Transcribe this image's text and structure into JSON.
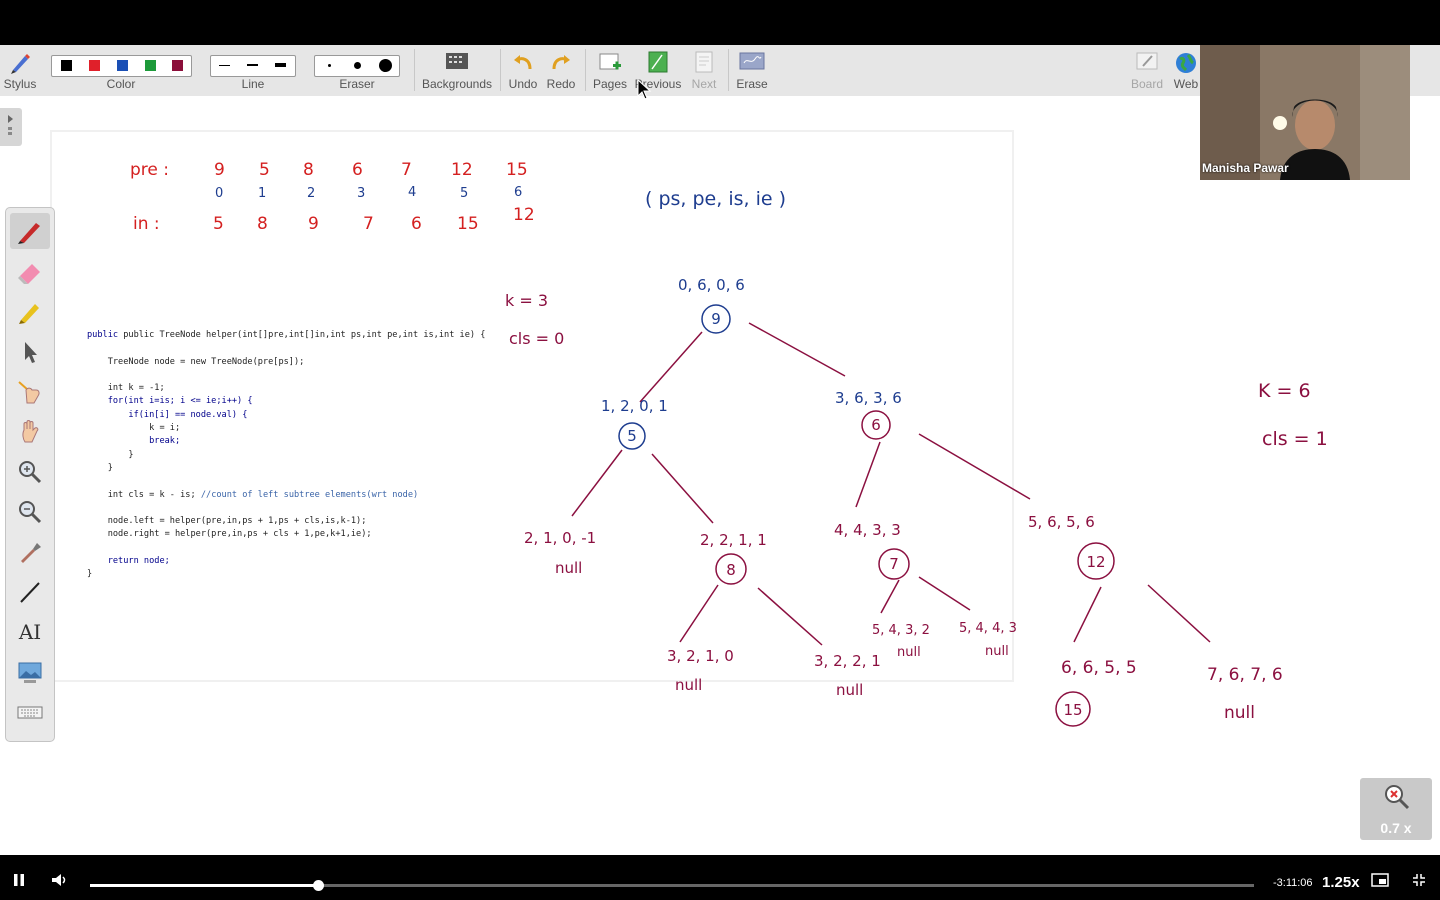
{
  "toolbar": {
    "stylus": "Stylus",
    "color": "Color",
    "line": "Line",
    "eraser": "Eraser",
    "backgrounds": "Backgrounds",
    "undo": "Undo",
    "redo": "Redo",
    "pages": "Pages",
    "previous": "Previous",
    "next": "Next",
    "erase": "Erase",
    "board": "Board",
    "web": "Web",
    "colors": [
      "#000000",
      "#e0202a",
      "#1a4fb5",
      "#1d9a3a",
      "#8b0e3a"
    ]
  },
  "sidebar": {
    "icons": [
      "pen-icon",
      "eraser-icon",
      "highlighter-icon",
      "pointer-icon",
      "laser-hand-icon",
      "pan-hand-icon",
      "zoom-in-icon",
      "zoom-out-icon",
      "eyedropper-icon",
      "line-tool-icon",
      "text-tool-icon",
      "image-icon",
      "keyboard-icon"
    ],
    "text_tool_label": "AI"
  },
  "code": {
    "l1": "public TreeNode helper(int[]pre,int[]in,int ps,int pe,int is,int ie) {",
    "l2": "TreeNode node = new TreeNode(pre[ps]);",
    "l3": "int k = -1;",
    "l4": "for(int i=is; i <= ie;i++) {",
    "l5": "if(in[i] == node.val) {",
    "l6": "k = i;",
    "l7": "break;",
    "l8": "}",
    "l9": "}",
    "l10": "int cls = k - is;",
    "l10c": "//count of left subtree elements(wrt node)",
    "l11": "node.left = helper(pre,in,ps + 1,ps + cls,is,k-1);",
    "l12": "node.right = helper(pre,in,ps + cls + 1,pe,k+1,ie);",
    "l13": "return node;",
    "l14": "}"
  },
  "notes": {
    "pre_label": "pre :",
    "pre_values": [
      "9",
      "5",
      "8",
      "6",
      "7",
      "12",
      "15"
    ],
    "indices": [
      "0",
      "1",
      "2",
      "3",
      "4",
      "5",
      "6"
    ],
    "in_label": "in :",
    "in_values": [
      "5",
      "8",
      "9",
      "7",
      "6",
      "15",
      "12"
    ],
    "signature": "( ps, pe, is, ie )",
    "k_note": "k = 3",
    "cls_note": "cls = 0",
    "k_note2": "K = 6",
    "cls_note2": "cls = 1"
  },
  "tree": {
    "root_range": "0, 6, 0, 6",
    "root_val": "9",
    "n5_range": "1, 2, 0, 1",
    "n5_val": "5",
    "n6_range": "3, 6, 3, 6",
    "n6_val": "6",
    "n5_left_range": "2, 1, 0, -1",
    "n5_left_null": "null",
    "n8_range": "2, 2, 1, 1",
    "n8_val": "8",
    "n8_left_range": "3, 2, 1, 0",
    "n8_left_null": "null",
    "n8_right_range": "3, 2, 2, 1",
    "n8_right_null": "null",
    "n7_range": "4, 4, 3, 3",
    "n7_val": "7",
    "n7_left_range": "5, 4, 3, 2",
    "n7_left_null": "null",
    "n7_right_range": "5, 4, 4, 3",
    "n7_right_null": "null",
    "n12_range": "5, 6, 5, 6",
    "n12_val": "12",
    "n15_range": "6, 6, 5, 5",
    "n15_val": "15",
    "n12_right_range": "7, 6, 7, 6",
    "n12_right_null": "null"
  },
  "webcam": {
    "name": "Manisha Pawar"
  },
  "zoom": {
    "value": "0.7 x"
  },
  "player": {
    "time": "-3:11:06",
    "speed": "1.25x",
    "progress": 0.196
  }
}
